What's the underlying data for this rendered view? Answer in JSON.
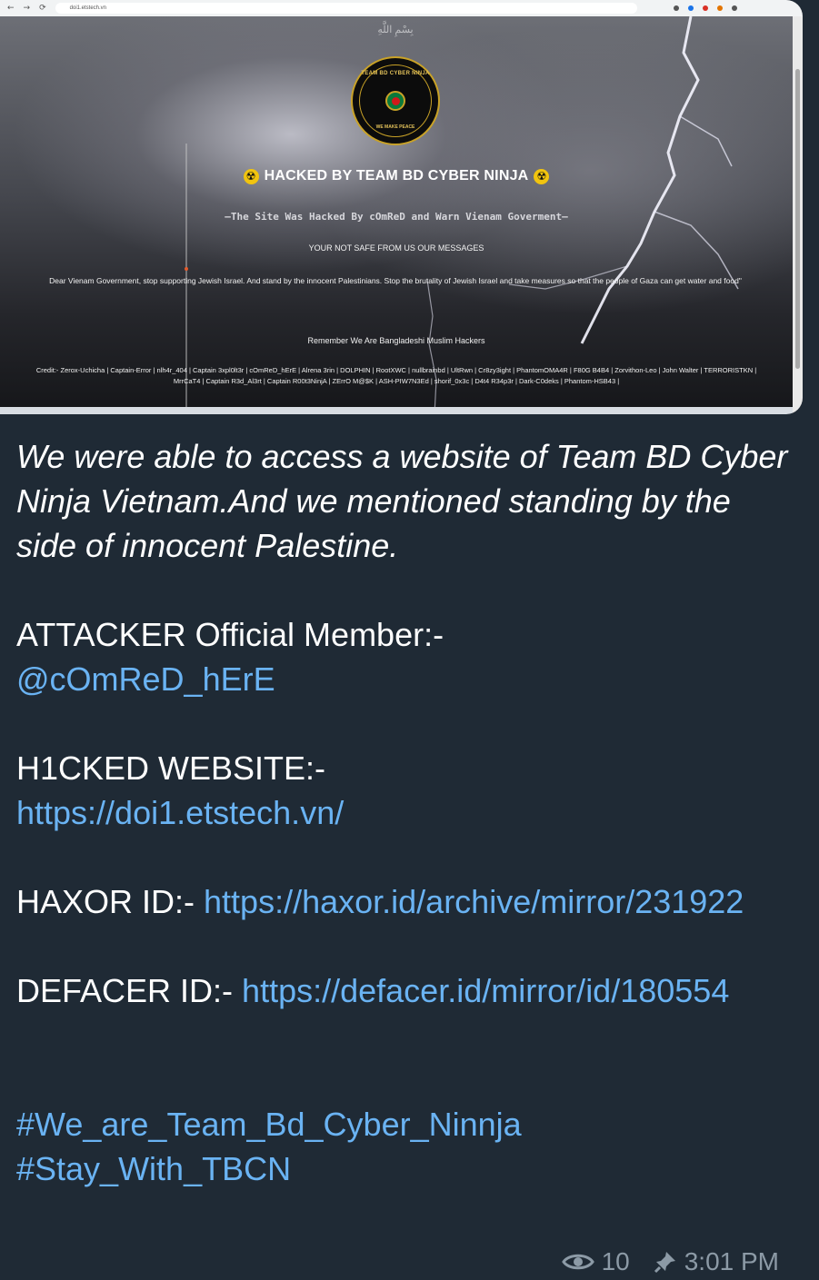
{
  "browser": {
    "nav_icons": [
      "←",
      "→",
      "⟳"
    ],
    "url": "doi1.etstech.vn"
  },
  "screenshot": {
    "arabic_deco": "بِسْمِ اللَّهِ",
    "logo": {
      "ring_top": "TEAM BD CYBER NINJA",
      "ring_bottom": "WE MAKE PEACE"
    },
    "title": "HACKED BY TEAM BD CYBER NINJA",
    "subtitle": "—The Site Was Hacked By cOmReD and Warn Vienam Goverment—",
    "line1": "YOUR NOT SAFE FROM US OUR MESSAGES",
    "message": "Dear Vienam Government, stop supporting Jewish Israel. And stand by the innocent Palestinians. Stop the brutality of Jewish Israel and take measures so that the people of Gaza can get water and food\"",
    "remember": "Remember We Are Bangladeshi Muslim Hackers",
    "credits": "Credit:- Zerox-Uchicha | Captain-Error | nlh4r_404 | Captain 3xpl0lt3r | cOmReD_hErE | Alrena 3rin | DOLPHIN | RootXWC | nullbrainbd | UltRwn | Cr8zy3ight | PhantomOMA4R | F80G B4B4 | Zorvithon-Leo | John Walter | TERRORISTKN | MrrCaT4 | Captain R3d_Al3rt | Captain R00t3NinjA | ZErrO M@$K | ASH-PIW7N3Ed | shorif_0x3c | D4t4 R34p3r | Dark-C0deks | Phantom-HSB43 |"
  },
  "post": {
    "intro": "We were able to access a website of Team BD Cyber Ninja Vietnam.And we mentioned standing by the side of innocent Palestine.",
    "attacker_label": "ATTACKER  Official Member:-",
    "attacker_handle": "@cOmReD_hErE",
    "website_label": "H1CKED WEBSITE:-",
    "website_url": "https://doi1.etstech.vn/",
    "haxor_label": "HAXOR ID:-",
    "haxor_url": "https://haxor.id/archive/mirror/231922",
    "defacer_label": "DEFACER ID:-",
    "defacer_url": "https://defacer.id/mirror/id/180554",
    "hashtag1": "#We_are_Team_Bd_Cyber_Ninnja",
    "hashtag2": "#Stay_With_TBCN",
    "views": "10",
    "time": "3:01 PM"
  },
  "colors": {
    "background": "#1f2a35",
    "link": "#6ab3f3",
    "meta": "#8c9aa6"
  }
}
